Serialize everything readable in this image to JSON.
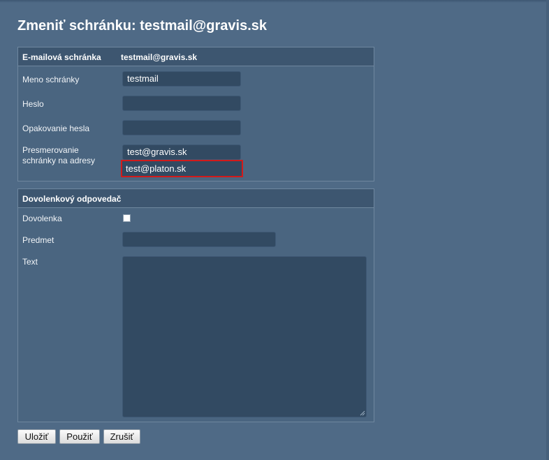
{
  "page": {
    "title": "Zmeniť schránku: testmail@gravis.sk"
  },
  "mailbox_section": {
    "header_label": "E-mailová schránka",
    "header_value": "testmail@gravis.sk",
    "name": {
      "label": "Meno schránky",
      "value": "testmail"
    },
    "password": {
      "label": "Heslo",
      "value": ""
    },
    "password_repeat": {
      "label": "Opakovanie hesla",
      "value": ""
    },
    "forwarding": {
      "label_line1": "Presmerovanie",
      "label_line2": "schránky na adresy",
      "addresses": [
        "test@gravis.sk",
        "test@platon.sk"
      ],
      "highlighted_index": 1,
      "highlight_color": "#d21a1a"
    }
  },
  "autoresponder_section": {
    "header_label": "Dovolenkový odpovedač",
    "vacation": {
      "label": "Dovolenka",
      "checked": false
    },
    "subject": {
      "label": "Predmet",
      "value": ""
    },
    "text": {
      "label": "Text",
      "value": ""
    }
  },
  "buttons": {
    "save": "Uložiť",
    "apply": "Použiť",
    "cancel": "Zrušiť"
  },
  "colors": {
    "background": "#4f6a86",
    "panel_header": "#3d5670",
    "input": "#324a62"
  }
}
